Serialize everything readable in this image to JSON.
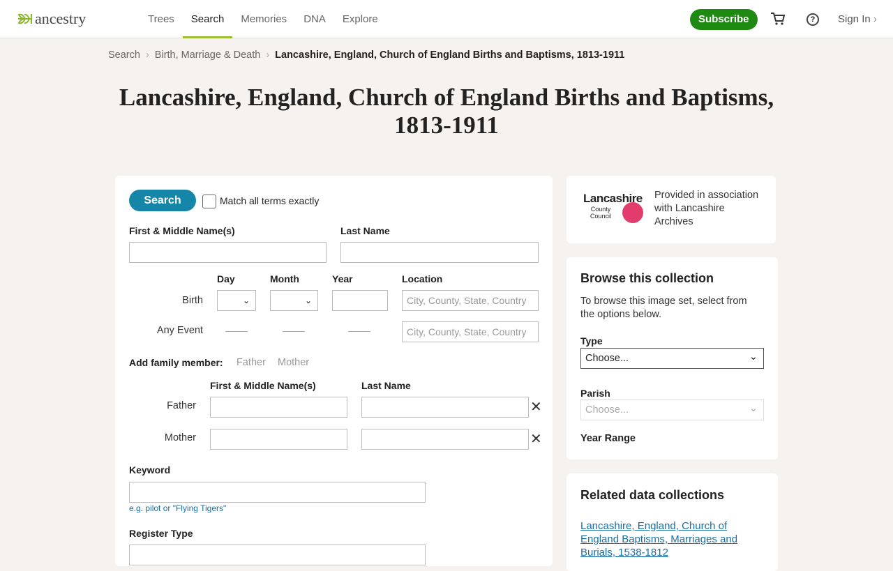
{
  "header": {
    "logo": "ancestry",
    "nav": [
      "Trees",
      "Search",
      "Memories",
      "DNA",
      "Explore"
    ],
    "active": "Search",
    "subscribe": "Subscribe",
    "signin": "Sign In"
  },
  "breadcrumb": [
    "Search",
    "Birth, Marriage & Death",
    "Lancashire, England, Church of England Births and Baptisms, 1813-1911"
  ],
  "title": "Lancashire, England, Church of England Births and Baptisms, 1813-1911",
  "form": {
    "search": "Search",
    "match": "Match all terms exactly",
    "first": "First & Middle Name(s)",
    "last": "Last Name",
    "day": "Day",
    "month": "Month",
    "year": "Year",
    "location": "Location",
    "birth": "Birth",
    "any_event": "Any Event",
    "loc_placeholder": "City, County, State, Country",
    "add_family": "Add family member:",
    "father": "Father",
    "mother": "Mother",
    "keyword": "Keyword",
    "keyword_hint": "e.g. pilot or \"Flying Tigers\"",
    "register_type": "Register Type"
  },
  "provider": {
    "logo_name": "Lancashire",
    "logo_sub": "County Council",
    "text": "Provided in association with Lancashire Archives"
  },
  "browse": {
    "title": "Browse this collection",
    "desc": "To browse this image set, select from the options below.",
    "type": "Type",
    "type_value": "Choose...",
    "parish": "Parish",
    "parish_value": "Choose...",
    "year_range": "Year Range"
  },
  "related": {
    "title": "Related data collections",
    "links": [
      "Lancashire, England, Church of England Baptisms, Marriages and Burials, 1538-1812"
    ]
  },
  "colors": {
    "accent": "#1585a8",
    "subscribe": "#1f8a12",
    "nav_underline": "#9cbe30"
  }
}
